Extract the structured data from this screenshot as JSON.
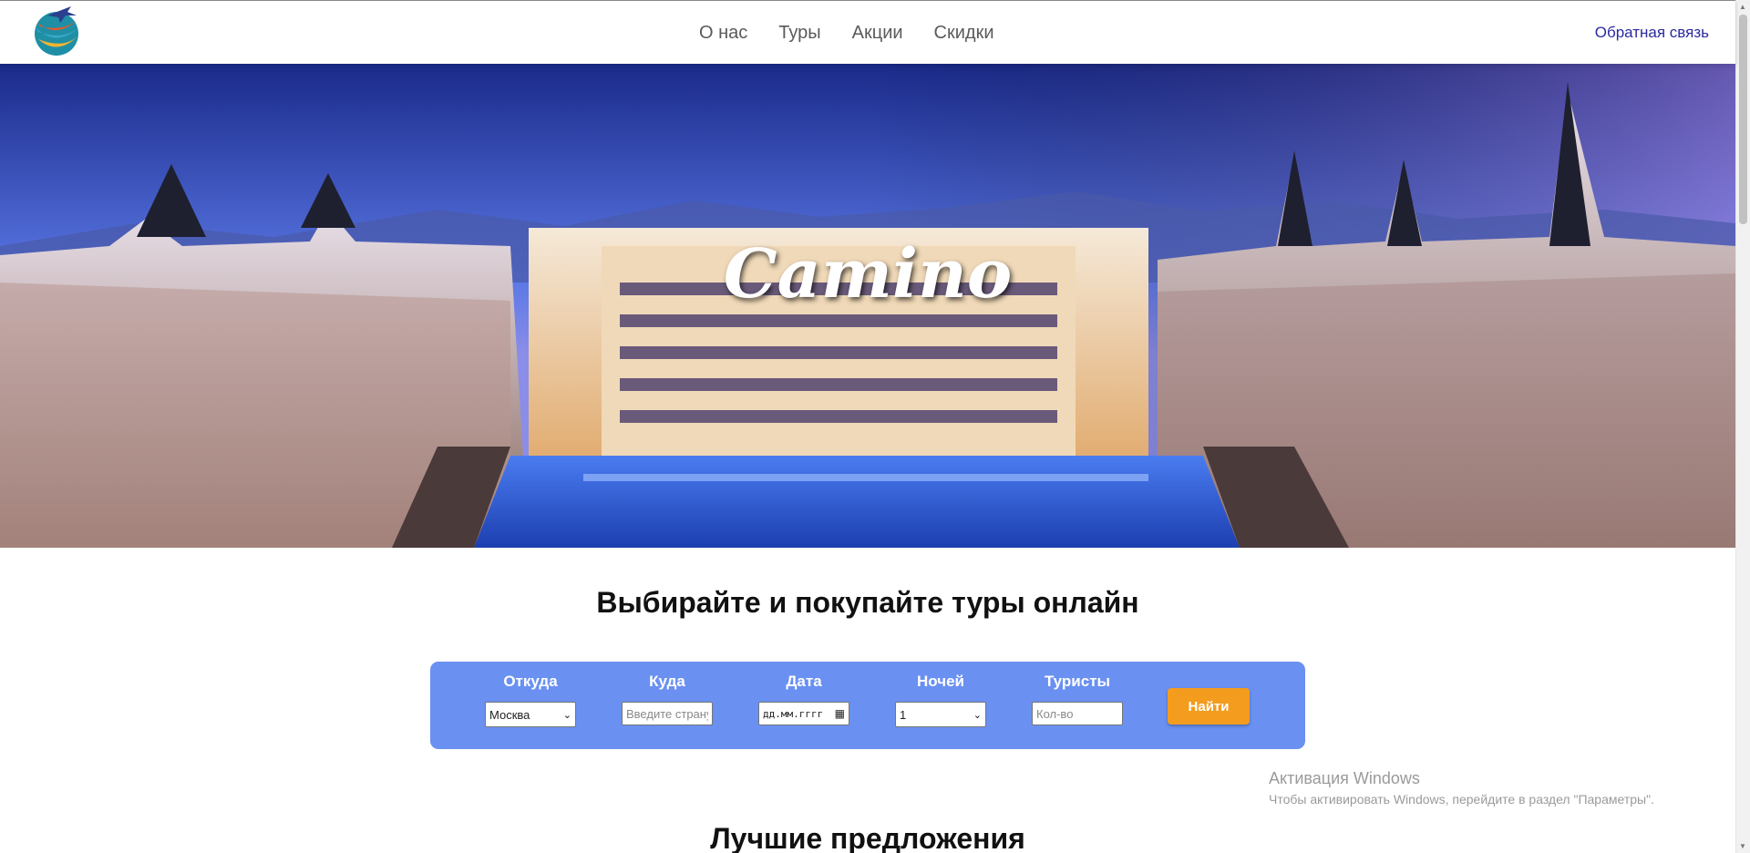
{
  "header": {
    "logo_name": "plane-globe-logo",
    "nav": [
      "О нас",
      "Туры",
      "Акции",
      "Скидки"
    ],
    "feedback": "Обратная связь"
  },
  "hero": {
    "title": "Camino"
  },
  "headline": "Выбирайте и покупайте туры онлайн",
  "search": {
    "from": {
      "label": "Откуда",
      "value": "Москва"
    },
    "to": {
      "label": "Куда",
      "placeholder": "Введите страну"
    },
    "date": {
      "label": "Дата",
      "placeholder": "дд.мм.гггг"
    },
    "nights": {
      "label": "Ночей",
      "value": "1"
    },
    "tourists": {
      "label": "Туристы",
      "placeholder": "Кол-во"
    },
    "button": "Найти"
  },
  "best_offers": "Лучшие предложения",
  "watermark": {
    "title": "Активация Windows",
    "subtitle": "Чтобы активировать Windows, перейдите в раздел \"Параметры\"."
  },
  "colors": {
    "panel": "#6a90f1",
    "button": "#f39c1e",
    "link": "#2a2aa0"
  }
}
